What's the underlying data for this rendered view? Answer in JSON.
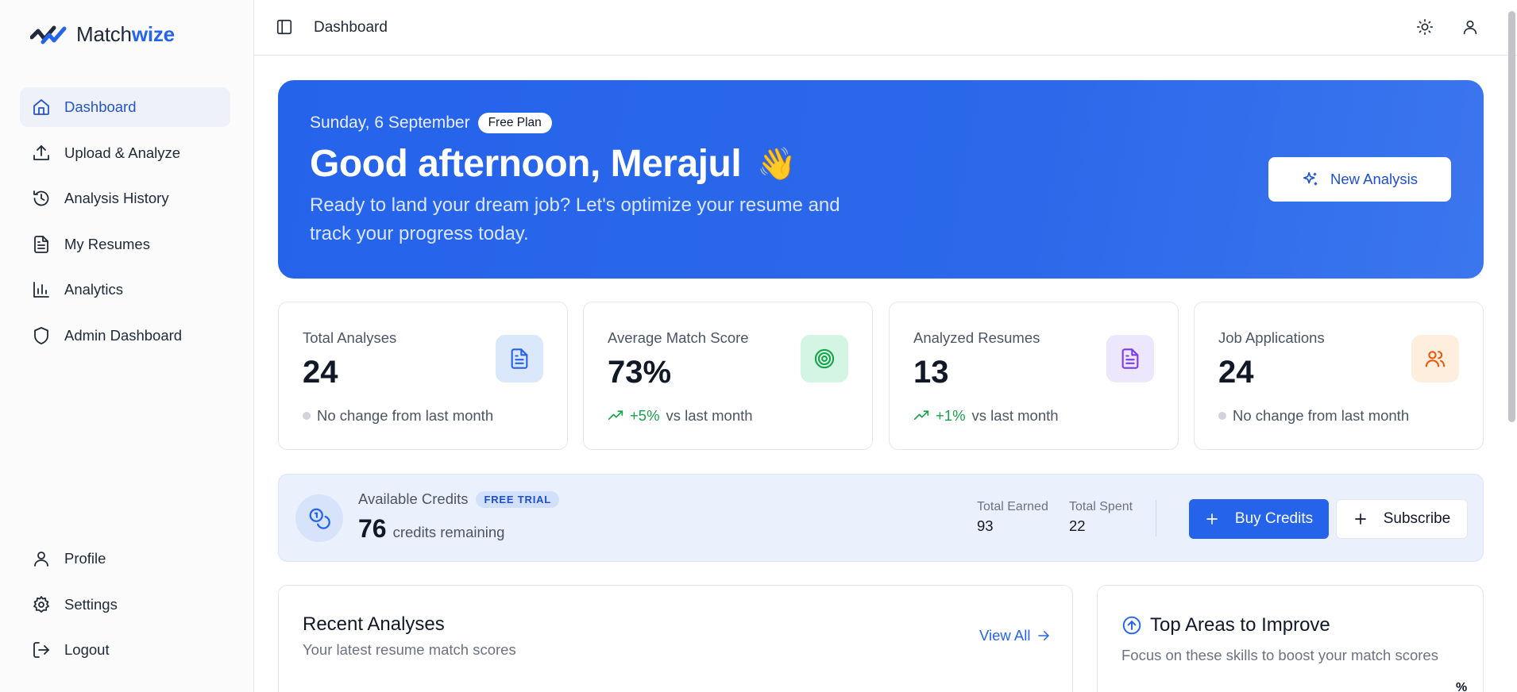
{
  "brand": {
    "name_plain": "Match",
    "name_accent": "wize",
    "accent_color": "#2563eb"
  },
  "sidebar": {
    "items": [
      {
        "label": "Dashboard",
        "icon": "home-icon",
        "active": true
      },
      {
        "label": "Upload & Analyze",
        "icon": "upload-icon"
      },
      {
        "label": "Analysis History",
        "icon": "history-icon"
      },
      {
        "label": "My Resumes",
        "icon": "document-icon"
      },
      {
        "label": "Analytics",
        "icon": "bar-chart-icon"
      },
      {
        "label": "Admin Dashboard",
        "icon": "shield-icon"
      }
    ],
    "bottom_items": [
      {
        "label": "Profile",
        "icon": "user-icon"
      },
      {
        "label": "Settings",
        "icon": "gear-icon"
      },
      {
        "label": "Logout",
        "icon": "logout-icon"
      }
    ]
  },
  "topbar": {
    "breadcrumb": "Dashboard"
  },
  "hero": {
    "date": "Sunday, 6 September",
    "plan": "Free Plan",
    "greeting": "Good afternoon, Merajul",
    "wave": "👋",
    "subtitle": "Ready to land your dream job? Let's optimize your resume and track your progress today.",
    "button": "New Analysis",
    "bg_color": "#2563eb"
  },
  "stats": [
    {
      "label": "Total Analyses",
      "value": "24",
      "trend": "none",
      "foot": "No change from last month",
      "icon": "document-icon",
      "badge_bg": "#dbe7fb",
      "icon_color": "#2563eb"
    },
    {
      "label": "Average Match Score",
      "value": "73%",
      "trend": "up",
      "delta": "+5%",
      "foot": "vs last month",
      "icon": "target-icon",
      "badge_bg": "#d4f5e4",
      "icon_color": "#16a34a"
    },
    {
      "label": "Analyzed Resumes",
      "value": "13",
      "trend": "up",
      "delta": "+1%",
      "foot": "vs last month",
      "icon": "document-icon",
      "badge_bg": "#ede7fd",
      "icon_color": "#7c3aed"
    },
    {
      "label": "Job Applications",
      "value": "24",
      "trend": "none",
      "foot": "No change from last month",
      "icon": "users-icon",
      "badge_bg": "#fdeedd",
      "icon_color": "#ea580c"
    }
  ],
  "credits": {
    "title": "Available Credits",
    "badge": "FREE TRIAL",
    "amount": "76",
    "amount_suffix": "credits remaining",
    "earned_label": "Total Earned",
    "earned": "93",
    "spent_label": "Total Spent",
    "spent": "22",
    "buy_label": "Buy Credits",
    "subscribe_label": "Subscribe"
  },
  "recent": {
    "title": "Recent Analyses",
    "subtitle": "Your latest resume match scores",
    "view_all": "View All"
  },
  "improve": {
    "title": "Top Areas to Improve",
    "subtitle": "Focus on these skills to boost your match scores",
    "unit": "%"
  }
}
